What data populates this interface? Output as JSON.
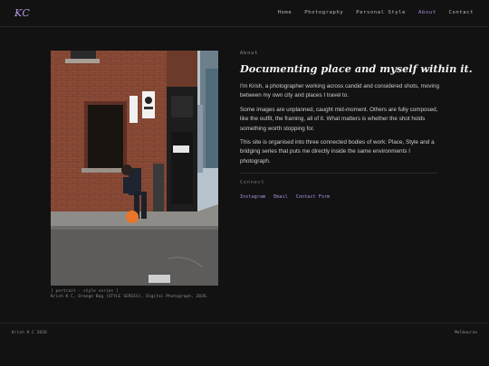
{
  "header": {
    "logo": "KC",
    "nav": [
      {
        "label": "Home"
      },
      {
        "label": "Photography"
      },
      {
        "label": "Personal Style"
      },
      {
        "label": "About"
      },
      {
        "label": "Contact"
      }
    ],
    "active_nav": "About"
  },
  "photo": {
    "caption_line1": "[ portrait · style series ]",
    "caption_line2": "Krish K C, Orange Bag (STYLE SERIES), Digital Photograph, 2026."
  },
  "about": {
    "eyebrow": "About",
    "headline": "Documenting place and myself within it.",
    "paragraphs": [
      "I'm Krish, a photographer working across candid and considered shots, moving between my own city and places I travel to.",
      "Some images are unplanned, caught mid-moment. Others are fully composed, like the outfit, the framing, all of it. What matters is whether the shot holds something worth stopping for.",
      "This site is organised into three connected bodies of work: Place, Style and a bridging series that puts me directly inside the same environments I photograph."
    ],
    "connect_label": "Connect",
    "links": [
      {
        "label": "Instagram"
      },
      {
        "label": "Email"
      },
      {
        "label": "Contact Form"
      }
    ]
  },
  "footer": {
    "left": "Krish K C 2026",
    "right": "Melbourne"
  },
  "colors": {
    "background": "#121212",
    "accent": "#a98ee0",
    "text": "#d6d6d6"
  }
}
